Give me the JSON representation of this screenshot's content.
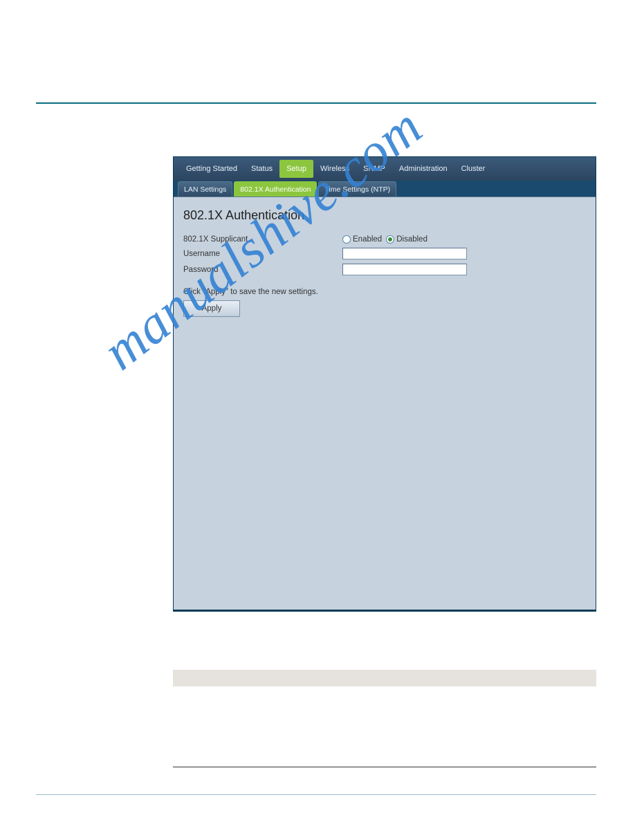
{
  "mainNav": {
    "items": [
      "Getting Started",
      "Status",
      "Setup",
      "Wireless",
      "SNMP",
      "Administration",
      "Cluster"
    ],
    "activeIndex": 2
  },
  "tabs": {
    "items": [
      "LAN Settings",
      "802.1X Authentication",
      "Time Settings (NTP)"
    ],
    "activeIndex": 1
  },
  "panel": {
    "title": "802.1X Authentication",
    "supplicantLabel": "802.1X Supplicant",
    "enabledLabel": "Enabled",
    "disabledLabel": "Disabled",
    "selected": "disabled",
    "usernameLabel": "Username",
    "usernameValue": "",
    "passwordLabel": "Password",
    "passwordValue": "",
    "hint": "Click \"Apply\" to save the new settings.",
    "applyLabel": "Apply"
  },
  "watermark": "manualshive.com"
}
